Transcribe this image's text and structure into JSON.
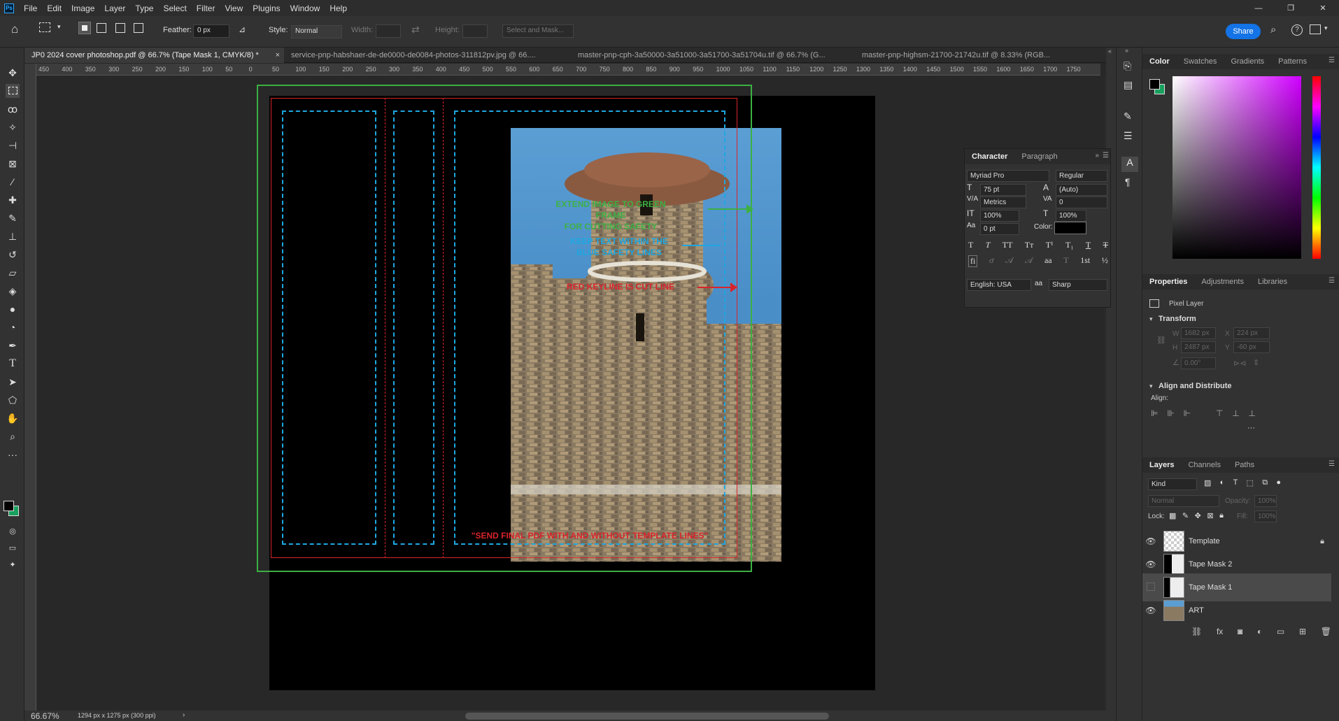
{
  "menubar": {
    "app_icon": "Ps",
    "items": [
      "File",
      "Edit",
      "Image",
      "Layer",
      "Type",
      "Select",
      "Filter",
      "View",
      "Plugins",
      "Window",
      "Help"
    ]
  },
  "options": {
    "feather_label": "Feather:",
    "feather_value": "0 px",
    "style_label": "Style:",
    "style_value": "Normal",
    "width_label": "Width:",
    "height_label": "Height:",
    "select_mask_label": "Select and Mask...",
    "share_label": "Share"
  },
  "tabs": [
    {
      "label": "JP0 2024 cover photoshop.pdf @ 66.7% (Tape Mask 1, CMYK/8) *"
    },
    {
      "label": "service-pnp-habshaer-de-de0000-de0084-photos-311812pv.jpg @ 66...."
    },
    {
      "label": "master-pnp-cph-3a50000-3a51000-3a51700-3a51704u.tif @ 66.7% (G..."
    },
    {
      "label": "master-pnp-highsm-21700-21742u.tif @ 8.33% (RGB..."
    }
  ],
  "ruler_ticks": [
    "450",
    "400",
    "350",
    "300",
    "250",
    "200",
    "150",
    "100",
    "50",
    "0",
    "50",
    "100",
    "150",
    "200",
    "250",
    "300",
    "350",
    "400",
    "450",
    "500",
    "550",
    "600",
    "650",
    "700",
    "750",
    "800",
    "850",
    "900",
    "950",
    "1000",
    "1050",
    "1100",
    "1150",
    "1200",
    "1250",
    "1300",
    "1350",
    "1400",
    "1450",
    "1500",
    "1550",
    "1600",
    "1650",
    "1700",
    "1750"
  ],
  "canvas": {
    "annotation_green": "EXTEND IMAGE TO GREEN FRAME\nFOR CUTTING SAFETY",
    "annotation_blue": "KEEP TEXT WITHIN THE\nBLUE SAFETY LINES",
    "annotation_red": "RED KEYLINE IS CUT LINE",
    "annotation_bottom": "\"SEND FINAL PDF WITH AND WITHOUT TEMPLATE LINES\""
  },
  "status": {
    "zoom": "66.67%",
    "doc_info": "1294 px x 1275 px (300 ppi)"
  },
  "character": {
    "tabs": [
      "Character",
      "Paragraph"
    ],
    "font_family": "Myriad Pro",
    "font_style": "Regular",
    "font_size": "75 pt",
    "leading": "(Auto)",
    "kerning": "Metrics",
    "tracking": "0",
    "vscale": "100%",
    "hscale": "100%",
    "baseline": "0 pt",
    "color_label": "Color:",
    "language": "English: USA",
    "aa_label": "aa",
    "antialias": "Sharp"
  },
  "color_panel": {
    "tabs": [
      "Color",
      "Swatches",
      "Gradients",
      "Patterns"
    ]
  },
  "properties": {
    "tabs": [
      "Properties",
      "Adjustments",
      "Libraries"
    ],
    "kind": "Pixel Layer",
    "transform_label": "Transform",
    "w": "1682 px",
    "h": "2487 px",
    "x": "224 px",
    "y": "-60 px",
    "angle": "0.00°",
    "align_label": "Align and Distribute",
    "align_sub": "Align:",
    "field_labels": {
      "w": "W",
      "h": "H",
      "x": "X",
      "y": "Y"
    }
  },
  "layers": {
    "tabs": [
      "Layers",
      "Channels",
      "Paths"
    ],
    "filter": "Kind",
    "blend": "Normal",
    "opacity_label": "Opacity:",
    "opacity": "100%",
    "lock_label": "Lock:",
    "fill_label": "Fill:",
    "fill": "100%",
    "items": [
      {
        "name": "Template",
        "visible": true,
        "locked": true
      },
      {
        "name": "Tape Mask 2",
        "visible": true
      },
      {
        "name": "Tape Mask 1",
        "visible": false,
        "selected": true
      },
      {
        "name": "ART",
        "visible": true
      }
    ]
  },
  "colors": {
    "green_frame": "#3cb043",
    "red_keyline": "#d9242b",
    "blue_safety": "#1ea7e1",
    "share_blue": "#1473e6"
  }
}
